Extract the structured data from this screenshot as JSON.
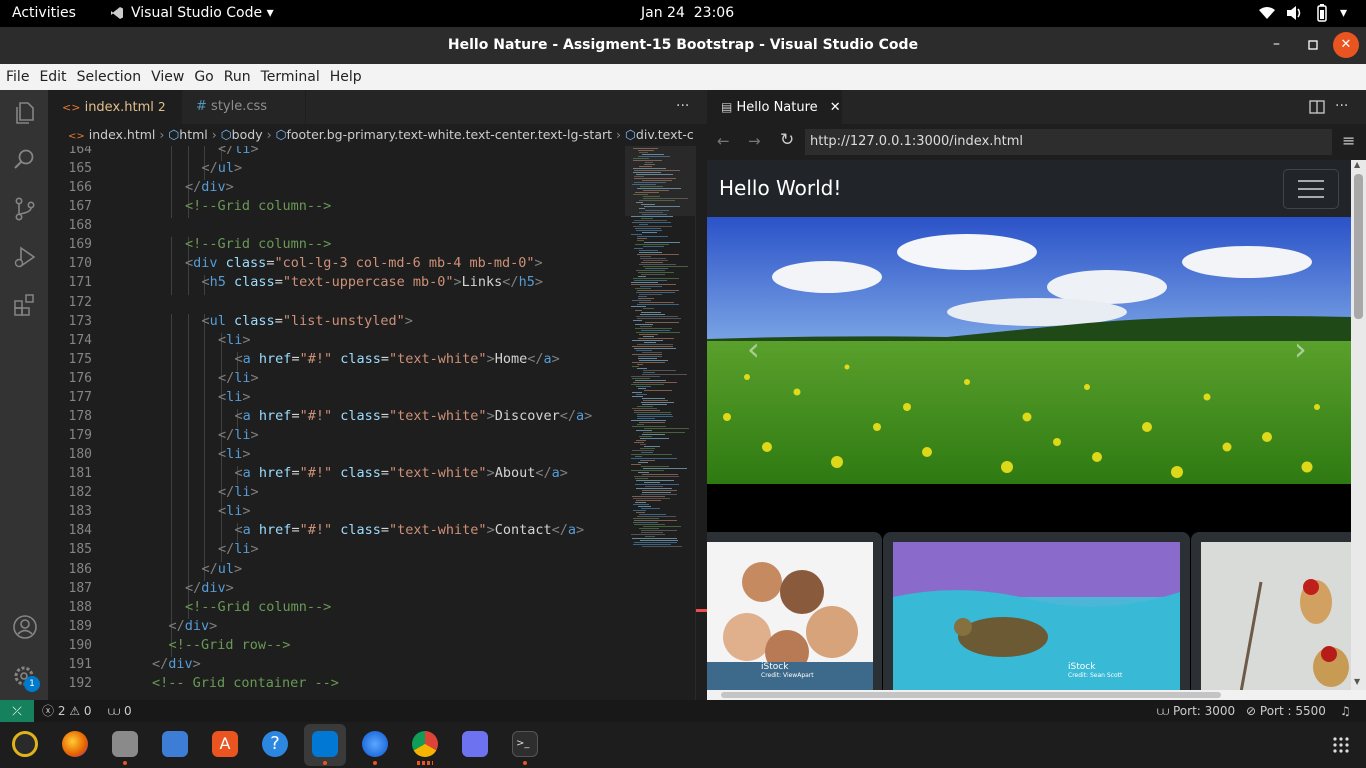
{
  "system": {
    "activities": "Activities",
    "app_name": "Visual Studio Code",
    "date": "Jan 24",
    "time": "23:06"
  },
  "window": {
    "title": "Hello Nature - Assigment-15 Bootstrap - Visual Studio Code"
  },
  "menu": [
    "File",
    "Edit",
    "Selection",
    "View",
    "Go",
    "Run",
    "Terminal",
    "Help"
  ],
  "tabs": [
    {
      "label": "index.html",
      "badge": "2",
      "icon": "html-icon"
    },
    {
      "label": "style.css",
      "icon": "css-icon"
    }
  ],
  "breadcrumb": [
    "index.html",
    "html",
    "body",
    "footer.bg-primary.text-white.text-center.text-lg-start",
    "div.text-c"
  ],
  "editor": {
    "line_numbers": [
      "164",
      "165",
      "166",
      "167",
      "168",
      "169",
      "170",
      "171",
      "172",
      "173",
      "174",
      "175",
      "176",
      "177",
      "178",
      "179",
      "180",
      "181",
      "182",
      "183",
      "184",
      "185",
      "186",
      "187",
      "188",
      "189",
      "190",
      "191",
      "192"
    ],
    "lines": [
      {
        "indent": 6,
        "segs": [
          [
            "tag",
            "</"
          ],
          [
            "tn",
            "li"
          ],
          [
            "tag",
            ">"
          ]
        ]
      },
      {
        "indent": 5,
        "segs": [
          [
            "tag",
            "</"
          ],
          [
            "tn",
            "ul"
          ],
          [
            "tag",
            ">"
          ]
        ]
      },
      {
        "indent": 4,
        "segs": [
          [
            "tag",
            "</"
          ],
          [
            "tn",
            "div"
          ],
          [
            "tag",
            ">"
          ]
        ]
      },
      {
        "indent": 4,
        "segs": [
          [
            "cm",
            "<!--Grid column-->"
          ]
        ]
      },
      {
        "indent": 0,
        "segs": []
      },
      {
        "indent": 4,
        "segs": [
          [
            "cm",
            "<!--Grid column-->"
          ]
        ]
      },
      {
        "indent": 4,
        "segs": [
          [
            "tag",
            "<"
          ],
          [
            "tn",
            "div"
          ],
          [
            "txt",
            " "
          ],
          [
            "at",
            "class"
          ],
          [
            "txt",
            "="
          ],
          [
            "sv",
            "\"col-lg-3 col-md-6 mb-4 mb-md-0\""
          ],
          [
            "tag",
            ">"
          ]
        ]
      },
      {
        "indent": 5,
        "segs": [
          [
            "tag",
            "<"
          ],
          [
            "tn",
            "h5"
          ],
          [
            "txt",
            " "
          ],
          [
            "at",
            "class"
          ],
          [
            "txt",
            "="
          ],
          [
            "sv",
            "\"text-uppercase mb-0\""
          ],
          [
            "tag",
            ">"
          ],
          [
            "txt",
            "Links"
          ],
          [
            "tag",
            "</"
          ],
          [
            "tn",
            "h5"
          ],
          [
            "tag",
            ">"
          ]
        ]
      },
      {
        "indent": 0,
        "segs": []
      },
      {
        "indent": 5,
        "segs": [
          [
            "tag",
            "<"
          ],
          [
            "tn",
            "ul"
          ],
          [
            "txt",
            " "
          ],
          [
            "at",
            "class"
          ],
          [
            "txt",
            "="
          ],
          [
            "sv",
            "\"list-unstyled\""
          ],
          [
            "tag",
            ">"
          ]
        ]
      },
      {
        "indent": 6,
        "segs": [
          [
            "tag",
            "<"
          ],
          [
            "tn",
            "li"
          ],
          [
            "tag",
            ">"
          ]
        ]
      },
      {
        "indent": 7,
        "segs": [
          [
            "tag",
            "<"
          ],
          [
            "tn",
            "a"
          ],
          [
            "txt",
            " "
          ],
          [
            "at",
            "href"
          ],
          [
            "txt",
            "="
          ],
          [
            "sv",
            "\"#!\""
          ],
          [
            "txt",
            " "
          ],
          [
            "at",
            "class"
          ],
          [
            "txt",
            "="
          ],
          [
            "sv",
            "\"text-white\""
          ],
          [
            "tag",
            ">"
          ],
          [
            "txt",
            "Home"
          ],
          [
            "tag",
            "</"
          ],
          [
            "tn",
            "a"
          ],
          [
            "tag",
            ">"
          ]
        ]
      },
      {
        "indent": 6,
        "segs": [
          [
            "tag",
            "</"
          ],
          [
            "tn",
            "li"
          ],
          [
            "tag",
            ">"
          ]
        ]
      },
      {
        "indent": 6,
        "segs": [
          [
            "tag",
            "<"
          ],
          [
            "tn",
            "li"
          ],
          [
            "tag",
            ">"
          ]
        ]
      },
      {
        "indent": 7,
        "segs": [
          [
            "tag",
            "<"
          ],
          [
            "tn",
            "a"
          ],
          [
            "txt",
            " "
          ],
          [
            "at",
            "href"
          ],
          [
            "txt",
            "="
          ],
          [
            "sv",
            "\"#!\""
          ],
          [
            "txt",
            " "
          ],
          [
            "at",
            "class"
          ],
          [
            "txt",
            "="
          ],
          [
            "sv",
            "\"text-white\""
          ],
          [
            "tag",
            ">"
          ],
          [
            "txt",
            "Discover"
          ],
          [
            "tag",
            "</"
          ],
          [
            "tn",
            "a"
          ],
          [
            "tag",
            ">"
          ]
        ]
      },
      {
        "indent": 6,
        "segs": [
          [
            "tag",
            "</"
          ],
          [
            "tn",
            "li"
          ],
          [
            "tag",
            ">"
          ]
        ]
      },
      {
        "indent": 6,
        "segs": [
          [
            "tag",
            "<"
          ],
          [
            "tn",
            "li"
          ],
          [
            "tag",
            ">"
          ]
        ]
      },
      {
        "indent": 7,
        "segs": [
          [
            "tag",
            "<"
          ],
          [
            "tn",
            "a"
          ],
          [
            "txt",
            " "
          ],
          [
            "at",
            "href"
          ],
          [
            "txt",
            "="
          ],
          [
            "sv",
            "\"#!\""
          ],
          [
            "txt",
            " "
          ],
          [
            "at",
            "class"
          ],
          [
            "txt",
            "="
          ],
          [
            "sv",
            "\"text-white\""
          ],
          [
            "tag",
            ">"
          ],
          [
            "txt",
            "About"
          ],
          [
            "tag",
            "</"
          ],
          [
            "tn",
            "a"
          ],
          [
            "tag",
            ">"
          ]
        ]
      },
      {
        "indent": 6,
        "segs": [
          [
            "tag",
            "</"
          ],
          [
            "tn",
            "li"
          ],
          [
            "tag",
            ">"
          ]
        ]
      },
      {
        "indent": 6,
        "segs": [
          [
            "tag",
            "<"
          ],
          [
            "tn",
            "li"
          ],
          [
            "tag",
            ">"
          ]
        ]
      },
      {
        "indent": 7,
        "segs": [
          [
            "tag",
            "<"
          ],
          [
            "tn",
            "a"
          ],
          [
            "txt",
            " "
          ],
          [
            "at",
            "href"
          ],
          [
            "txt",
            "="
          ],
          [
            "sv",
            "\"#!\""
          ],
          [
            "txt",
            " "
          ],
          [
            "at",
            "class"
          ],
          [
            "txt",
            "="
          ],
          [
            "sv",
            "\"text-white\""
          ],
          [
            "tag",
            ">"
          ],
          [
            "txt",
            "Contact"
          ],
          [
            "tag",
            "</"
          ],
          [
            "tn",
            "a"
          ],
          [
            "tag",
            ">"
          ]
        ]
      },
      {
        "indent": 6,
        "segs": [
          [
            "tag",
            "</"
          ],
          [
            "tn",
            "li"
          ],
          [
            "tag",
            ">"
          ]
        ]
      },
      {
        "indent": 5,
        "segs": [
          [
            "tag",
            "</"
          ],
          [
            "tn",
            "ul"
          ],
          [
            "tag",
            ">"
          ]
        ]
      },
      {
        "indent": 4,
        "segs": [
          [
            "tag",
            "</"
          ],
          [
            "tn",
            "div"
          ],
          [
            "tag",
            ">"
          ]
        ]
      },
      {
        "indent": 4,
        "segs": [
          [
            "cm",
            "<!--Grid column-->"
          ]
        ]
      },
      {
        "indent": 3,
        "segs": [
          [
            "tag",
            "</"
          ],
          [
            "tn",
            "div"
          ],
          [
            "tag",
            ">"
          ]
        ]
      },
      {
        "indent": 3,
        "segs": [
          [
            "cm",
            "<!--Grid row-->"
          ]
        ]
      },
      {
        "indent": 2,
        "segs": [
          [
            "tag",
            "</"
          ],
          [
            "tn",
            "div"
          ],
          [
            "tag",
            ">"
          ]
        ]
      },
      {
        "indent": 2,
        "segs": [
          [
            "cm",
            "<!-- Grid container -->"
          ]
        ]
      }
    ]
  },
  "preview": {
    "tab_label": "Hello Nature",
    "url": "http://127.0.0.1:3000/index.html",
    "brand": "Hello World!",
    "card_watermark": "iStock",
    "card1_credit": "Credit: ViewApart",
    "card2_credit": "Credit: Sean Scott"
  },
  "status": {
    "errors": "2",
    "warnings": "0",
    "ports": "0",
    "port_live": "Port: 3000",
    "port_right": "Port : 5500"
  },
  "colors": {
    "accent": "#007acc",
    "remote": "#16825d",
    "dock_bg": "#1d1d1d"
  }
}
